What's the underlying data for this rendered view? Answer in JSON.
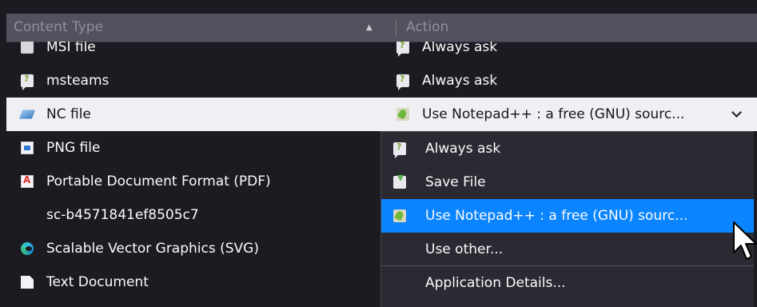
{
  "table": {
    "headers": {
      "content_type": "Content Type",
      "action": "Action"
    },
    "rows": [
      {
        "content_type": "MSI file",
        "action": "Always ask",
        "type_icon": "msi-icon",
        "action_icon": "chat-icon"
      },
      {
        "content_type": "msteams",
        "action": "Always ask",
        "type_icon": "chat-icon",
        "action_icon": "chat-icon"
      },
      {
        "content_type": "NC file",
        "action": "Use Notepad++ : a free (GNU) sourc...",
        "type_icon": "nc-file-icon",
        "action_icon": "notepad-plus-plus-icon",
        "selected": true
      },
      {
        "content_type": "PNG file",
        "action": "",
        "type_icon": "png-file-icon"
      },
      {
        "content_type": "Portable Document Format (PDF)",
        "action": "",
        "type_icon": "pdf-icon"
      },
      {
        "content_type": "sc-b4571841ef8505c7",
        "action": ""
      },
      {
        "content_type": "Scalable Vector Graphics (SVG)",
        "action": "",
        "type_icon": "edge-icon"
      },
      {
        "content_type": "Text Document",
        "action": "",
        "type_icon": "document-icon"
      }
    ]
  },
  "dropdown": {
    "options": [
      {
        "label": "Always ask",
        "icon": "chat-icon"
      },
      {
        "label": "Save File",
        "icon": "save-icon"
      },
      {
        "label": "Use Notepad++ : a free (GNU) sourc...",
        "icon": "notepad-plus-plus-icon",
        "highlighted": true
      },
      {
        "label": "Use other..."
      },
      {
        "label": "Application Details..."
      }
    ]
  },
  "colors": {
    "background": "#1c1b22",
    "header": "#52525e",
    "selected_row": "#f0f0f4",
    "highlight": "#0a84ff",
    "dropdown": "#2b2a33"
  }
}
